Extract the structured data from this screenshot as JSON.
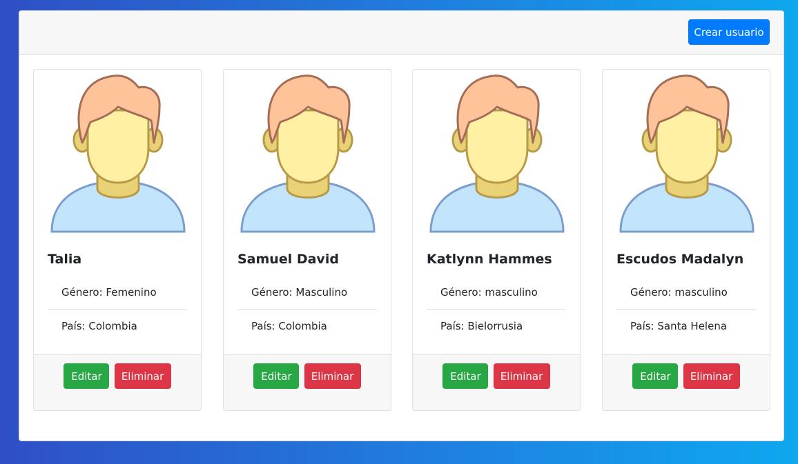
{
  "header": {
    "create_label": "Crear usuario"
  },
  "users": [
    {
      "name": "Talia",
      "gender": "Género: Femenino",
      "country": "País: Colombia"
    },
    {
      "name": "Samuel David",
      "gender": "Género: Masculino",
      "country": "País: Colombia"
    },
    {
      "name": "Katlynn Hammes",
      "gender": "Género: masculino",
      "country": "País: Bielorrusia"
    },
    {
      "name": "Escudos Madalyn",
      "gender": "Género: masculino",
      "country": "País: Santa Helena"
    }
  ],
  "actions": {
    "edit_label": "Editar",
    "delete_label": "Eliminar"
  },
  "icons": {
    "avatar": "user-avatar-icon"
  },
  "colors": {
    "primary": "#007bff",
    "success": "#28a745",
    "danger": "#dc3545"
  }
}
